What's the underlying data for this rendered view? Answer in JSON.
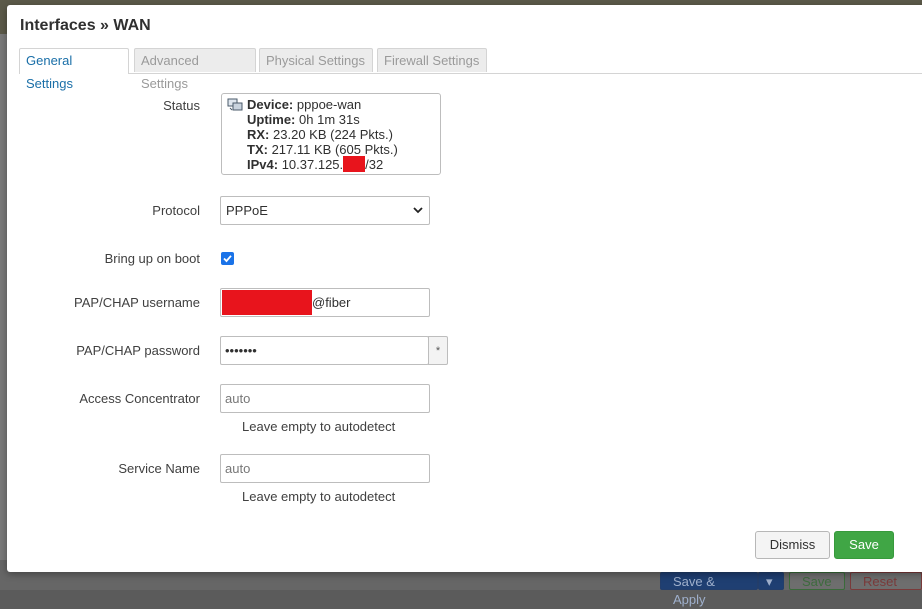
{
  "background": {
    "buttons": {
      "save_apply": "Save & Apply",
      "save": "Save",
      "reset": "Reset"
    }
  },
  "modal": {
    "title": "Interfaces » WAN",
    "tabs": [
      {
        "label": "General Settings",
        "active": true
      },
      {
        "label": "Advanced Settings",
        "active": false
      },
      {
        "label": "Physical Settings",
        "active": false
      },
      {
        "label": "Firewall Settings",
        "active": false
      }
    ],
    "status": {
      "label": "Status",
      "device_key": "Device:",
      "device_val": "pppoe-wan",
      "uptime_key": "Uptime:",
      "uptime_val": "0h 1m 31s",
      "rx_key": "RX:",
      "rx_val": "23.20 KB (224 Pkts.)",
      "tx_key": "TX:",
      "tx_val": "217.11 KB (605 Pkts.)",
      "ipv4_key": "IPv4:",
      "ipv4_prefix": "10.37.125.",
      "ipv4_suffix": "/32"
    },
    "protocol": {
      "label": "Protocol",
      "value": "PPPoE"
    },
    "boot": {
      "label": "Bring up on boot",
      "checked": true
    },
    "username": {
      "label": "PAP/CHAP username",
      "value_suffix": "@fiber"
    },
    "password": {
      "label": "PAP/CHAP password",
      "value": "•••••••",
      "reveal": "*"
    },
    "access_concentrator": {
      "label": "Access Concentrator",
      "placeholder": "auto",
      "hint": "Leave empty to autodetect"
    },
    "service_name": {
      "label": "Service Name",
      "placeholder": "auto",
      "hint": "Leave empty to autodetect"
    },
    "buttons": {
      "dismiss": "Dismiss",
      "save": "Save"
    }
  }
}
